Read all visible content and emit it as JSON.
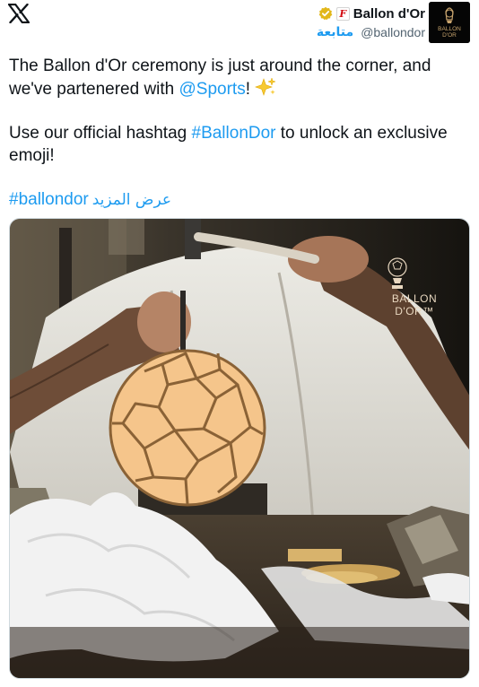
{
  "header": {
    "display_name": "Ballon d'Or",
    "handle": "@ballondor",
    "follow_label": "متابعة",
    "brand_badge_letter": "F",
    "icons": [
      "x-logo-icon",
      "verified-badge-icon",
      "affiliate-badge-icon",
      "avatar-ballon-dor-logo"
    ]
  },
  "avatar": {
    "line1": "BALLON",
    "line2": "D'OR"
  },
  "tweet": {
    "line1_before": "The Ballon d'Or ceremony is just around the corner, and we've partenered with ",
    "mention": "@Sports",
    "line1_after": "! ",
    "line2_before": "Use our official hashtag ",
    "hashtag_main": "#BallonDor",
    "line2_after": " to unlock an exclusive emoji!",
    "hashtag_footer": "#ballondor",
    "show_more": "عرض المزيد"
  },
  "media": {
    "brand_line1": "BALLON",
    "brand_line2": "D'OR™",
    "description_icon": "golden-ball-emoji-photo"
  },
  "colors": {
    "link": "#1d9bf0",
    "verified_gold": "#e2b719",
    "ball_fill": "#f5c58b",
    "ball_lines": "#8a6236"
  }
}
